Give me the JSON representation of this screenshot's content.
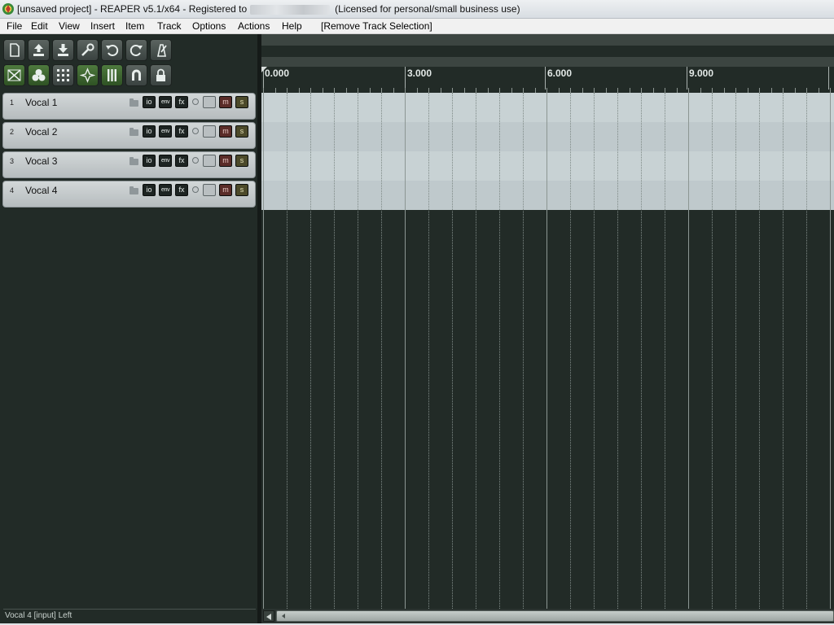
{
  "window": {
    "title_prefix": "[unsaved project] - REAPER v5.1/x64 - Registered to",
    "title_suffix": "(Licensed for personal/small business use)"
  },
  "menu": {
    "items": [
      {
        "label": "File"
      },
      {
        "label": "Edit"
      },
      {
        "label": "View"
      },
      {
        "label": "Insert"
      },
      {
        "label": "Item"
      },
      {
        "label": "Track"
      },
      {
        "label": "Options"
      },
      {
        "label": "Actions"
      },
      {
        "label": "Help"
      },
      {
        "label": "[Remove Track Selection]"
      }
    ]
  },
  "toolbar": {
    "row1": [
      {
        "icon": "new-project-icon"
      },
      {
        "icon": "open-project-icon"
      },
      {
        "icon": "save-project-icon"
      },
      {
        "icon": "project-settings-icon"
      },
      {
        "icon": "undo-icon"
      },
      {
        "icon": "redo-icon"
      },
      {
        "icon": "metronome-icon"
      }
    ],
    "row2": [
      {
        "icon": "auto-crossfade-icon",
        "active": true
      },
      {
        "icon": "item-grouping-icon",
        "active": true
      },
      {
        "icon": "grid-icon",
        "active": false
      },
      {
        "icon": "ripple-edit-icon",
        "active": true
      },
      {
        "icon": "snap-icon",
        "active": true
      },
      {
        "icon": "magnet-icon",
        "active": false
      },
      {
        "icon": "lock-icon",
        "active": false
      }
    ]
  },
  "tracks": [
    {
      "number": "1",
      "name": "Vocal 1"
    },
    {
      "number": "2",
      "name": "Vocal 2"
    },
    {
      "number": "3",
      "name": "Vocal 3"
    },
    {
      "number": "4",
      "name": "Vocal 4"
    }
  ],
  "track_buttons": {
    "io": "io",
    "env": "env",
    "fx": "fx",
    "mute": "m",
    "solo": "s"
  },
  "ruler": {
    "labels": [
      "0.000",
      "3.000",
      "6.000",
      "9.000"
    ],
    "unit_seconds_per_label": 3
  },
  "status": {
    "text": "Vocal 4 [input] Left"
  },
  "colors": {
    "background": "#222b27",
    "lane_light": "#c8d2d4",
    "mute": "#5a2c28",
    "solo": "#4c4a2a"
  }
}
